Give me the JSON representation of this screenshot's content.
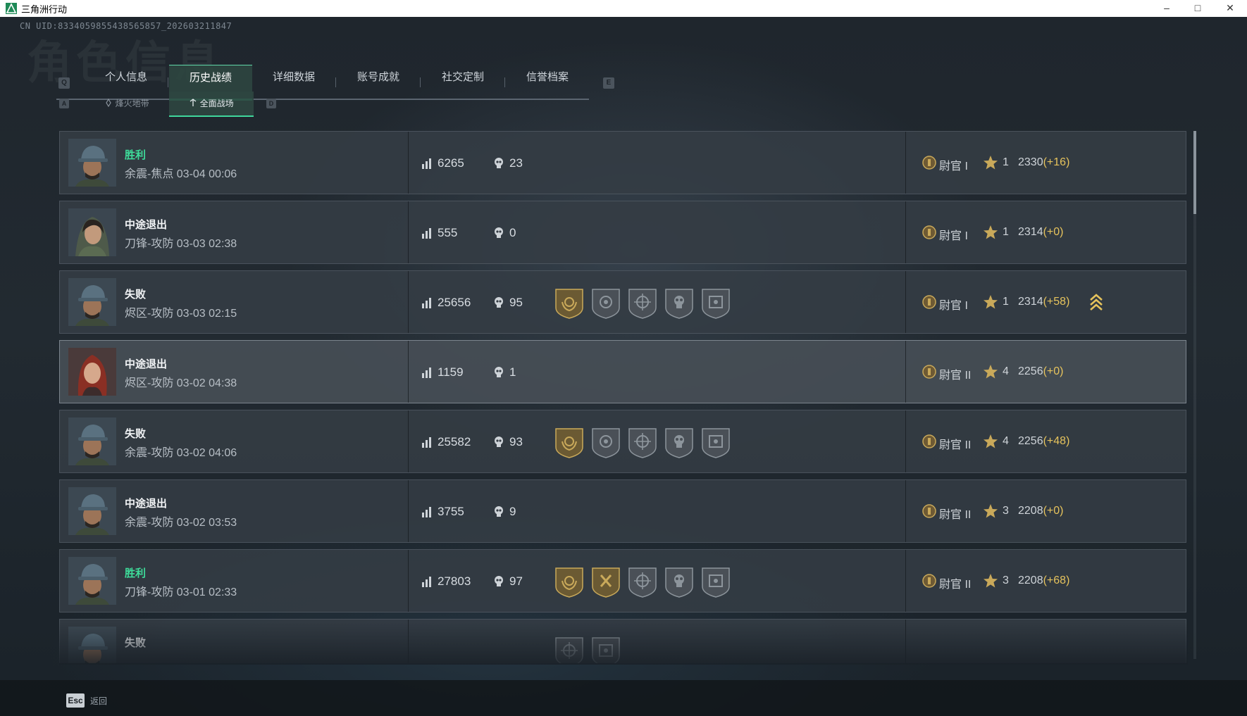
{
  "window": {
    "title": "三角洲行动",
    "minimize": "–",
    "maximize": "□",
    "close": "✕"
  },
  "uid": "CN UID:8334059855438565857_202603211847",
  "background_text": "角色信息",
  "tabs": {
    "prev_key": "Q",
    "next_key": "E",
    "items": [
      {
        "label": "个人信息",
        "active": false
      },
      {
        "label": "历史战绩",
        "active": true
      },
      {
        "label": "详细数据",
        "active": false
      },
      {
        "label": "账号成就",
        "active": false
      },
      {
        "label": "社交定制",
        "active": false
      },
      {
        "label": "信誉档案",
        "active": false
      }
    ]
  },
  "subtabs": {
    "prev_key": "A",
    "next_key": "D",
    "items": [
      {
        "label": "烽火地带",
        "active": false
      },
      {
        "label": "全面战场",
        "active": true
      }
    ]
  },
  "colors": {
    "accent": "#3fd79c",
    "win": "#3edc9a",
    "delta": "#e6c35c",
    "gold": "#c9a95a"
  },
  "matches": [
    {
      "result": "胜利",
      "win": true,
      "info": "余震-焦点 03-04 00:06",
      "score": "6265",
      "kills": "23",
      "badges": [],
      "rank": "尉官 I",
      "rank_level": "1",
      "stars": "1",
      "points": "2330",
      "delta": "(+16)",
      "promoted": false,
      "avatar": "male-cap"
    },
    {
      "result": "中途退出",
      "win": false,
      "info": "刀锋-攻防 03-03 02:38",
      "score": "555",
      "kills": "0",
      "badges": [],
      "rank": "尉官 I",
      "rank_level": "1",
      "stars": "1",
      "points": "2314",
      "delta": "(+0)",
      "promoted": false,
      "avatar": "female-hood"
    },
    {
      "result": "失败",
      "win": false,
      "info": "烬区-攻防 03-03 02:15",
      "score": "25656",
      "kills": "95",
      "badges": [
        "gold-wreath",
        "grey-shield",
        "grey-crosshair",
        "grey-skull",
        "grey-scope"
      ],
      "rank": "尉官 I",
      "rank_level": "1",
      "stars": "1",
      "points": "2314",
      "delta": "(+58)",
      "promoted": true,
      "avatar": "male-cap"
    },
    {
      "result": "中途退出",
      "win": false,
      "info": "烬区-攻防 03-02 04:38",
      "score": "1159",
      "kills": "1",
      "badges": [],
      "rank": "尉官 II",
      "rank_level": "2",
      "stars": "4",
      "points": "2256",
      "delta": "(+0)",
      "promoted": false,
      "avatar": "female-red"
    },
    {
      "result": "失败",
      "win": false,
      "info": "余震-攻防 03-02 04:06",
      "score": "25582",
      "kills": "93",
      "badges": [
        "gold-wreath",
        "grey-shield",
        "grey-crosshair",
        "grey-skull",
        "grey-scope"
      ],
      "rank": "尉官 II",
      "rank_level": "2",
      "stars": "4",
      "points": "2256",
      "delta": "(+48)",
      "promoted": false,
      "avatar": "male-cap"
    },
    {
      "result": "中途退出",
      "win": false,
      "info": "余震-攻防 03-02 03:53",
      "score": "3755",
      "kills": "9",
      "badges": [],
      "rank": "尉官 II",
      "rank_level": "2",
      "stars": "3",
      "points": "2208",
      "delta": "(+0)",
      "promoted": false,
      "avatar": "male-cap"
    },
    {
      "result": "胜利",
      "win": true,
      "info": "刀锋-攻防 03-01 02:33",
      "score": "27803",
      "kills": "97",
      "badges": [
        "gold-wreath",
        "gold-hammer",
        "grey-crosshair",
        "grey-skull",
        "grey-scope"
      ],
      "rank": "尉官 II",
      "rank_level": "2",
      "stars": "3",
      "points": "2208",
      "delta": "(+68)",
      "promoted": false,
      "avatar": "male-cap"
    },
    {
      "result": "失败",
      "win": false,
      "info": "",
      "score": "",
      "kills": "",
      "badges": [
        "grey-crosshair",
        "grey-scope"
      ],
      "rank": "",
      "rank_level": "",
      "stars": "",
      "points": "",
      "delta": "",
      "promoted": true,
      "avatar": "male-cap"
    }
  ],
  "footer": {
    "esc_key": "Esc",
    "back_label": "返回"
  }
}
